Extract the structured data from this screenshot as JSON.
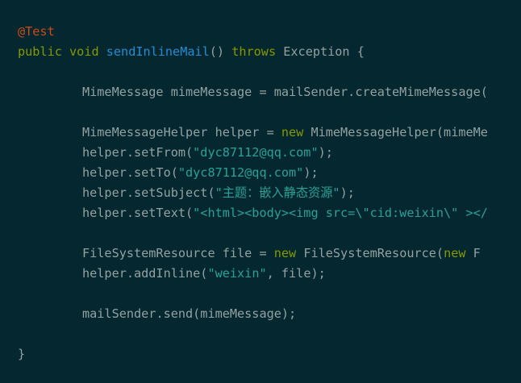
{
  "colors": {
    "background": "#052830",
    "plain": "#93a1a1",
    "keyword": "#859900",
    "annotation": "#cb4b16",
    "method_name": "#268bd2",
    "string": "#2aa198"
  },
  "code": {
    "line1": {
      "annotation": "@Test"
    },
    "line2": {
      "kw_public": "public",
      "kw_void": "void",
      "method": "sendInlineMail",
      "parens": "()",
      "kw_throws": "throws",
      "exception": "Exception {"
    },
    "line4": {
      "text": "MimeMessage mimeMessage = mailSender.createMimeMessage("
    },
    "line6": {
      "pre": "MimeMessageHelper helper = ",
      "kw_new": "new",
      "post": " MimeMessageHelper(mimeMe"
    },
    "line7": {
      "pre": "helper.setFrom(",
      "str": "\"dyc87112@qq.com\"",
      "post": ");"
    },
    "line8": {
      "pre": "helper.setTo(",
      "str": "\"dyc87112@qq.com\"",
      "post": ");"
    },
    "line9": {
      "pre": "helper.setSubject(",
      "str": "\"主题：嵌入静态资源\"",
      "post": ");"
    },
    "line10": {
      "pre": "helper.setText(",
      "str": "\"<html><body><img src=\\\"cid:weixin\\\" ></"
    },
    "line12": {
      "pre": "FileSystemResource file = ",
      "kw_new": "new",
      "mid": " FileSystemResource(",
      "kw_new2": "new",
      "post": " F"
    },
    "line13": {
      "pre": "helper.addInline(",
      "str": "\"weixin\"",
      "post": ", file);"
    },
    "line15": {
      "text": "mailSender.send(mimeMessage);"
    },
    "line17": {
      "text": "}"
    }
  }
}
